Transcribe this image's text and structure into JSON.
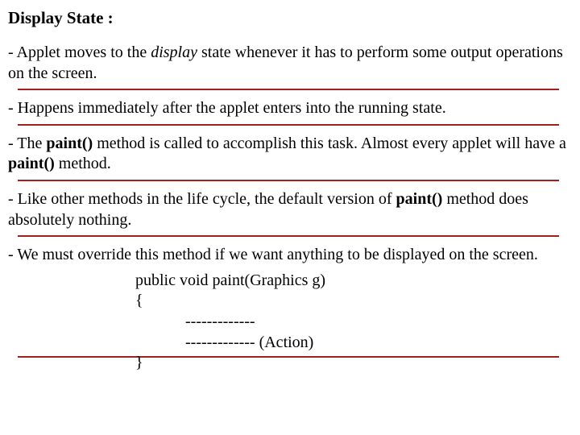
{
  "heading": "Display State :",
  "p1_a": "- Applet moves to the ",
  "p1_display": "display",
  "p1_b": " state whenever it has to perform some output operations on the screen.",
  "p2": "- Happens immediately after the applet enters into the running state.",
  "p3_a": "- The ",
  "p3_paint1": "paint()",
  "p3_b": " method is called to accomplish this task. Almost every applet will have a ",
  "p3_paint2": "paint()",
  "p3_c": " method.",
  "p4_a": "- Like other methods in the life cycle, the default version of ",
  "p4_paint": "paint()",
  "p4_b": " method does absolutely nothing.",
  "p5": "- We must override this method if we want anything to be displayed on the screen.",
  "code_sig": "public void paint(Graphics g)",
  "code_open": "{",
  "code_l1": "-------------",
  "code_l2": "------------- (Action)",
  "code_close": "}"
}
